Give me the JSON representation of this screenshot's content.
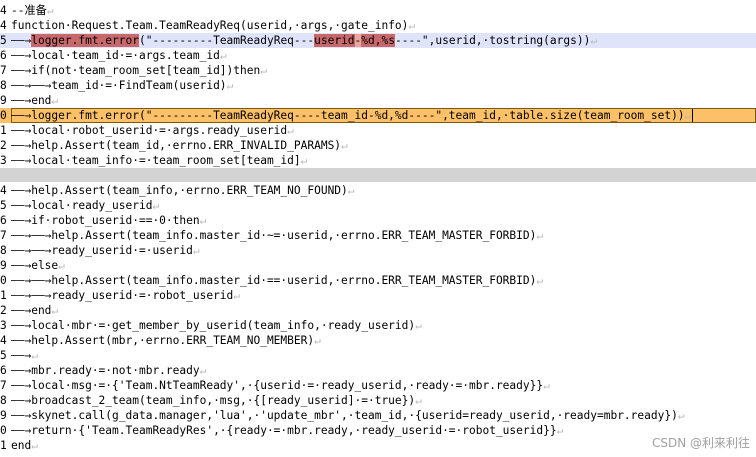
{
  "editor": {
    "lines": [
      {
        "num": "4",
        "text": "--准备",
        "cr": "↵"
      },
      {
        "num": "4",
        "text": "function·Request.Team.TeamReadyReq(userid,·args,·gate_info)",
        "cr": "↵"
      },
      {
        "num": "5",
        "pre": "——→",
        "mark1": "logger.fmt.error",
        "mid1": "(\"---------TeamReadyReq---",
        "mark2": "userid",
        "mid2": "-",
        "mark3": "%d,%s",
        "post": "----\",userid,·tostring(args))",
        "cr": "↵"
      },
      {
        "num": "6",
        "text": "——→local·team_id·=·args.team_id",
        "cr": "↵"
      },
      {
        "num": "7",
        "text": "——→if(not·team_room_set[team_id])then",
        "cr": "↵"
      },
      {
        "num": "8",
        "text": "——→——→team_id·=·FindTeam(userid)",
        "cr": "↵"
      },
      {
        "num": "9",
        "text": "——→end",
        "cr": "↵"
      },
      {
        "num": "0",
        "text": "——→logger.fmt.error(\"---------TeamReadyReq----team_id-%d,%d----\",team_id,·table.size(team_room_set))",
        "cr": "↵"
      },
      {
        "num": "1",
        "text": "——→local·robot_userid·=·args.ready_userid",
        "cr": "↵"
      },
      {
        "num": "2",
        "text": "——→help.Assert(team_id,·errno.ERR_INVALID_PARAMS)",
        "cr": "↵"
      },
      {
        "num": "3",
        "text": "——→local·team_info·=·team_room_set[team_id]",
        "cr": "↵"
      },
      {
        "num": "4",
        "text": "——→help.Assert(team_info,·errno.ERR_TEAM_NO_FOUND)",
        "cr": "↵"
      },
      {
        "num": "5",
        "text": "——→local·ready_userid",
        "cr": "↵"
      },
      {
        "num": "6",
        "text": "——→if·robot_userid·==·0·then",
        "cr": "↵"
      },
      {
        "num": "7",
        "text": "——→——→help.Assert(team_info.master_id·~=·userid,·errno.ERR_TEAM_MASTER_FORBID)",
        "cr": "↵"
      },
      {
        "num": "8",
        "text": "——→——→ready_userid·=·userid",
        "cr": "↵"
      },
      {
        "num": "9",
        "text": "——→else",
        "cr": "↵"
      },
      {
        "num": "0",
        "text": "——→——→help.Assert(team_info.master_id·==·userid,·errno.ERR_TEAM_MASTER_FORBID)",
        "cr": "↵"
      },
      {
        "num": "1",
        "text": "——→——→ready_userid·=·robot_userid",
        "cr": "↵"
      },
      {
        "num": "2",
        "text": "——→end",
        "cr": "↵"
      },
      {
        "num": "3",
        "text": "——→local·mbr·=·get_member_by_userid(team_info,·ready_userid)",
        "cr": "↵"
      },
      {
        "num": "4",
        "text": "——→help.Assert(mbr,·errno.ERR_TEAM_NO_MEMBER)",
        "cr": "↵"
      },
      {
        "num": "5",
        "text": "——→",
        "cr": "↵"
      },
      {
        "num": "6",
        "text": "——→mbr.ready·=·not·mbr.ready",
        "cr": "↵"
      },
      {
        "num": "7",
        "text": "——→local·msg·=·{'Team.NtTeamReady',·{userid·=·ready_userid,·ready·=·mbr.ready}}",
        "cr": "↵"
      },
      {
        "num": "8",
        "text": "——→broadcast_2_team(team_info,·msg,·{[ready_userid]·=·true})",
        "cr": "↵"
      },
      {
        "num": "9",
        "text": "——→skynet.call(g_data.manager,'lua',·'update_mbr',·team_id,·{userid=ready_userid,·ready=mbr.ready})",
        "cr": "↵"
      },
      {
        "num": "0",
        "text": "——→return·{'Team.TeamReadyRes',·{ready·=·mbr.ready,·ready_userid·=·robot_userid}}",
        "cr": "↵"
      },
      {
        "num": "1",
        "text": "end",
        "cr": "↵"
      }
    ]
  },
  "watermark": "CSDN @利来利往"
}
